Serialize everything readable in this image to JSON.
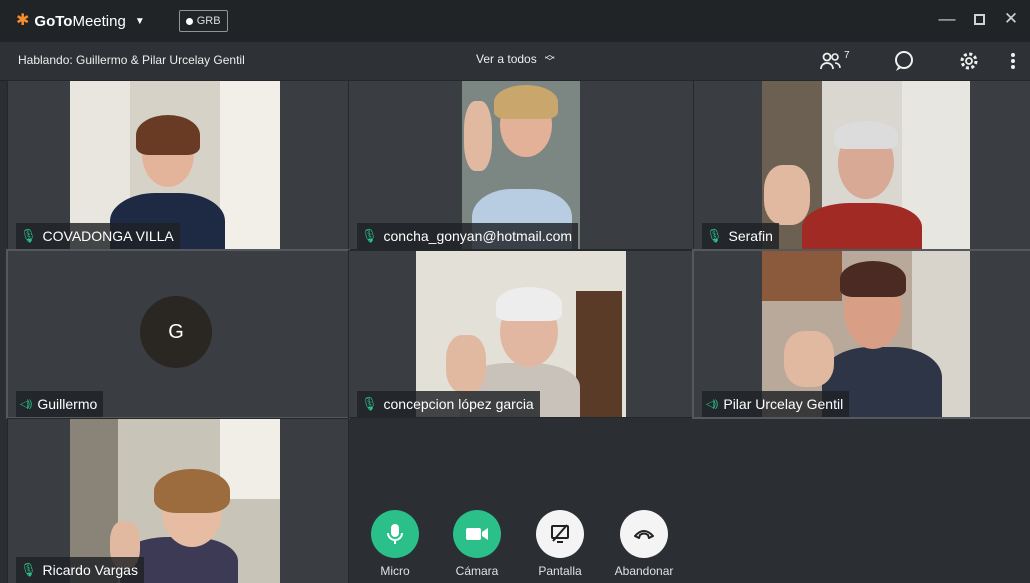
{
  "app": {
    "brand": "GoTo",
    "brand_suffix": "Meeting",
    "grb_label": "GRB"
  },
  "toolbar": {
    "speaking": "Hablando: Guillermo & Pilar Urcelay Gentil",
    "view_all": "Ver a todos",
    "participants_count": "7"
  },
  "tiles": [
    {
      "name": "COVADONGA VILLA",
      "audio": "mic"
    },
    {
      "name": "concha_gonyan@hotmail.com",
      "audio": "mic"
    },
    {
      "name": "Serafin",
      "audio": "mic"
    },
    {
      "name": "Guillermo",
      "audio": "speaker",
      "avatar_letter": "G"
    },
    {
      "name": "concepcion lópez garcia",
      "audio": "mic"
    },
    {
      "name": "Pilar Urcelay Gentil",
      "audio": "speaker"
    },
    {
      "name": "Ricardo Vargas",
      "audio": "mic"
    }
  ],
  "controls": {
    "micro": "Micro",
    "camera": "Cámara",
    "screen": "Pantalla",
    "leave": "Abandonar"
  },
  "colors": {
    "accent_green": "#2bc08a",
    "brand_orange": "#f68d2e",
    "background": "#2b2f33"
  }
}
